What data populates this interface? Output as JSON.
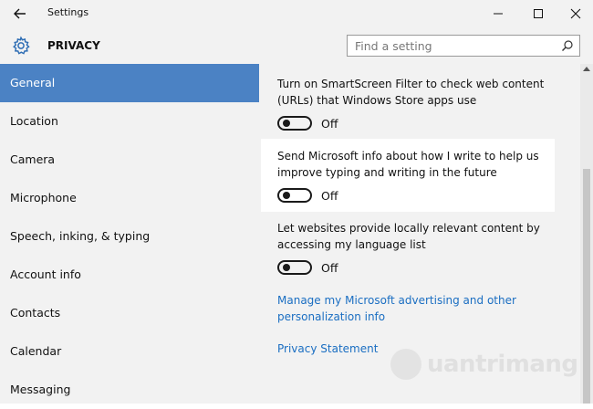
{
  "window": {
    "title": "Settings"
  },
  "header": {
    "section": "PRIVACY",
    "search_placeholder": "Find a setting"
  },
  "sidebar": {
    "items": [
      {
        "label": "General",
        "active": true
      },
      {
        "label": "Location"
      },
      {
        "label": "Camera"
      },
      {
        "label": "Microphone"
      },
      {
        "label": "Speech, inking, & typing"
      },
      {
        "label": "Account info"
      },
      {
        "label": "Contacts"
      },
      {
        "label": "Calendar"
      },
      {
        "label": "Messaging"
      }
    ]
  },
  "settings": [
    {
      "text": "Turn on SmartScreen Filter to check web content (URLs) that Windows Store apps use",
      "state": "Off"
    },
    {
      "text": "Send Microsoft info about how I write to help us improve typing and writing in the future",
      "state": "Off"
    },
    {
      "text": "Let websites provide locally relevant content by accessing my language list",
      "state": "Off"
    }
  ],
  "links": {
    "advertising": "Manage my Microsoft advertising and other personalization info",
    "privacy_statement": "Privacy Statement"
  },
  "watermark": {
    "text": "uantrimang"
  },
  "colors": {
    "accent": "#4b82c4",
    "link": "#1a6ec2",
    "background": "#f2f2f2"
  }
}
